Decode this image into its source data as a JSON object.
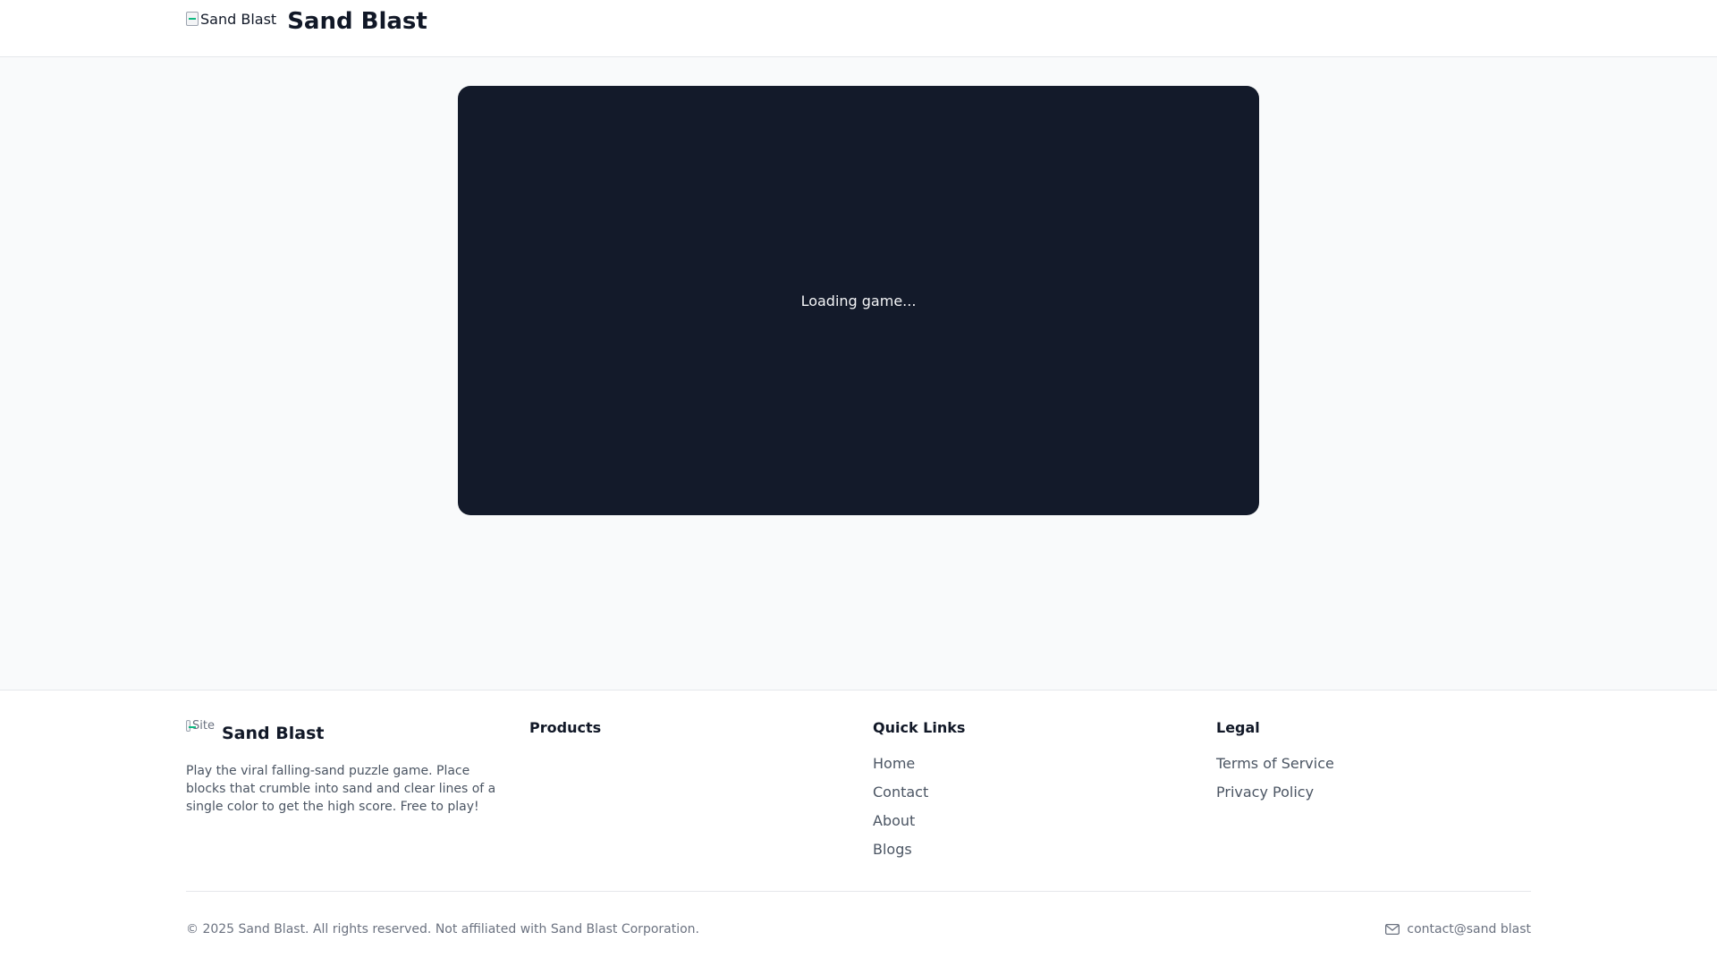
{
  "header": {
    "logo_alt": "Sand Blast",
    "site_name": "Sand Blast"
  },
  "game": {
    "loading_text": "Loading game..."
  },
  "footer": {
    "logo_alt": "Site",
    "site_name": "Sand Blast",
    "description": "Play the viral falling-sand puzzle game. Place blocks that crumble into sand and clear lines of a single color to get the high score. Free to play!",
    "products": {
      "title": "Products",
      "items": []
    },
    "quick_links": {
      "title": "Quick Links",
      "items": [
        "Home",
        "Contact",
        "About",
        "Blogs"
      ]
    },
    "legal": {
      "title": "Legal",
      "items": [
        "Terms of Service",
        "Privacy Policy"
      ]
    },
    "copyright": "© 2025 Sand Blast. All rights reserved. Not affiliated with Sand Blast Corporation.",
    "contact_email": "contact@sand blast",
    "contact_icon": "mail-icon"
  },
  "colors": {
    "page_bg": "#f9fafb",
    "header_bg": "#ffffff",
    "game_bg": "#131a2a",
    "text_primary": "#111827",
    "text_secondary": "#4b5563",
    "text_muted": "#6b7280"
  }
}
